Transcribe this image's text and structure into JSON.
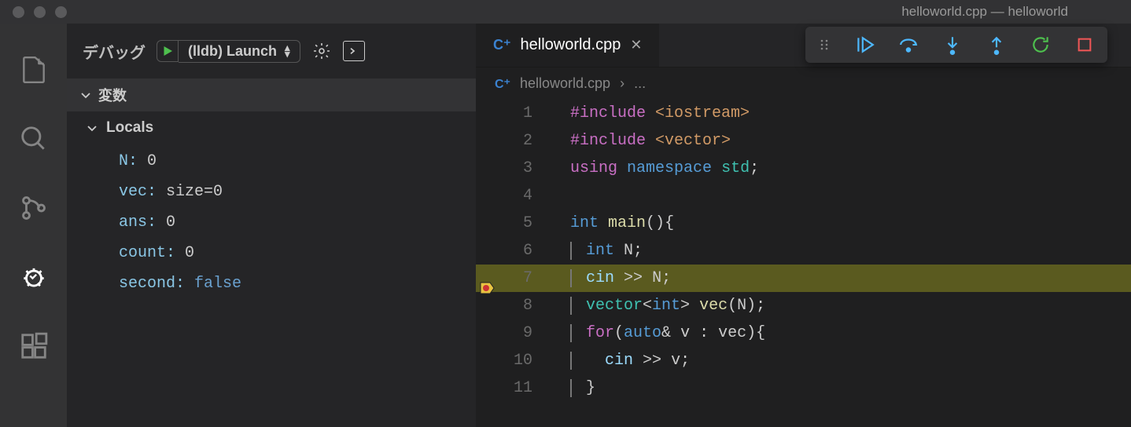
{
  "window": {
    "title": "helloworld.cpp — helloworld"
  },
  "debug": {
    "title": "デバッグ",
    "config": "(lldb) Launch",
    "sections": {
      "variables": "変数",
      "locals": "Locals"
    },
    "vars": [
      {
        "name": "N:",
        "value": "0"
      },
      {
        "name": "vec:",
        "value": "size=0"
      },
      {
        "name": "ans:",
        "value": "0"
      },
      {
        "name": "count:",
        "value": "0"
      },
      {
        "name": "second:",
        "value": "false",
        "cls": "false"
      }
    ]
  },
  "editor": {
    "tab": "helloworld.cpp",
    "breadcrumb": {
      "file": "helloworld.cpp",
      "rest": "..."
    },
    "currentLine": 7,
    "lines": [
      {
        "n": "1"
      },
      {
        "n": "2"
      },
      {
        "n": "3"
      },
      {
        "n": "4"
      },
      {
        "n": "5"
      },
      {
        "n": "6"
      },
      {
        "n": "7"
      },
      {
        "n": "8"
      },
      {
        "n": "9"
      },
      {
        "n": "10"
      },
      {
        "n": "11"
      }
    ],
    "tokens": {
      "include": "#include",
      "iostream": "<iostream>",
      "vector_h": "<vector>",
      "using": "using",
      "namespace": "namespace",
      "std": "std",
      "semi": ";",
      "int": "int",
      "main": "main",
      "parens": "()",
      "lbrace": "{",
      "N": "N",
      "cin": "cin",
      "shr": ">>",
      "vector_t": "vector",
      "lt": "<",
      "gt": ">",
      "vec": "vec",
      "lpar": "(",
      "rpar": ")",
      "for": "for",
      "auto": "auto",
      "amp": "&",
      "v": "v",
      "colon": ":",
      "rbrace": "}"
    }
  }
}
